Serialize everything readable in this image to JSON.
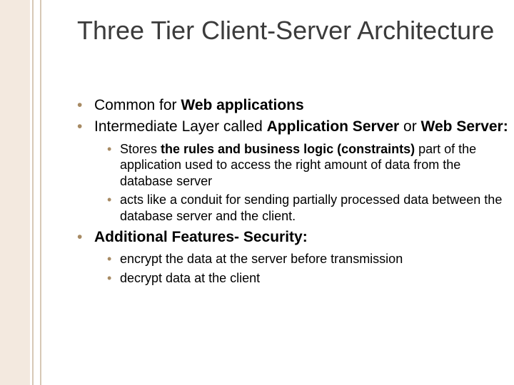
{
  "title": "Three Tier Client-Server Architecture",
  "bullets": {
    "b1_pre": "Common for ",
    "b1_bold": "Web applications",
    "b2_pre": "Intermediate Layer called ",
    "b2_bold1": "Application Server",
    "b2_mid": " or ",
    "b2_bold2": "Web Server:",
    "b2_sub1_pre": "Stores ",
    "b2_sub1_bold": "the rules and business logic (constraints)",
    "b2_sub1_post": " part of the application used to access the right amount of data from the database server",
    "b2_sub2": "acts like a conduit for sending partially processed data between the database server and the client.",
    "b3_bold": "Additional Features- Security:",
    "b3_sub1": "encrypt the data at the server before transmission",
    "b3_sub2": "decrypt data at the client"
  }
}
